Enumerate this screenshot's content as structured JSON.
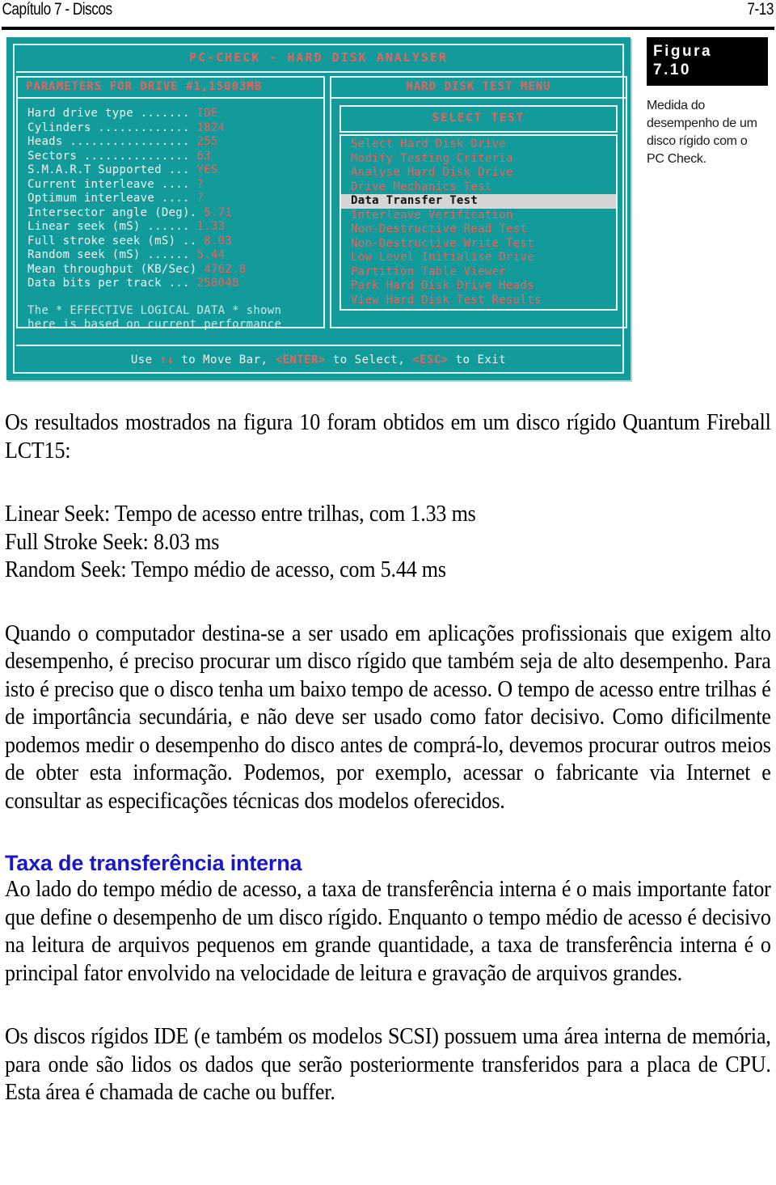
{
  "header": {
    "chapter": "Capítulo 7 - Discos",
    "folio": "7-13"
  },
  "figure": {
    "screen_title": "PC-CHECK - HARD DISK ANALYSER",
    "left_panel": {
      "heading": "PARAMETERS FOR DRIVE #1,15003MB",
      "rows": [
        {
          "label": "Hard drive type .......",
          "value": "IDE"
        },
        {
          "label": "Cylinders .............",
          "value": "1824"
        },
        {
          "label": "Heads .................",
          "value": "255"
        },
        {
          "label": "Sectors ...............",
          "value": "63"
        },
        {
          "label": "S.M.A.R.T Supported ...",
          "value": "YES"
        },
        {
          "label": "Current interleave ....",
          "value": "?"
        },
        {
          "label": "Optimum interleave ....",
          "value": "?"
        },
        {
          "label": "Intersector angle (Deg).",
          "value": "5.71"
        },
        {
          "label": "Linear seek (mS) ......",
          "value": "1.33"
        },
        {
          "label": "Full stroke seek (mS) ..",
          "value": "8.03"
        },
        {
          "label": "Random seek (mS) ......",
          "value": "5.44"
        },
        {
          "label": "Mean throughput (KB/Sec)",
          "value": "4762.8"
        },
        {
          "label": "Data bits per track ...",
          "value": "258048"
        }
      ],
      "note_line1": "The * EFFECTIVE LOGICAL DATA * shown",
      "note_line2": "here is based on current performance"
    },
    "right_panel": {
      "heading": "HARD DISK TEST MENU",
      "select_test_label": "SELECT TEST",
      "menu_items": [
        {
          "label": "Select Hard Disk Drive",
          "selected": false
        },
        {
          "label": "Modify Testing Criteria",
          "selected": false
        },
        {
          "label": "Analyse Hard Disk Drive",
          "selected": false
        },
        {
          "label": "Drive Mechanics Test",
          "selected": false
        },
        {
          "label": "Data Transfer Test",
          "selected": true
        },
        {
          "label": "Interleave Verification",
          "selected": false
        },
        {
          "label": "Non-Destructive Read Test",
          "selected": false
        },
        {
          "label": "Non-Destructive Write Test",
          "selected": false
        },
        {
          "label": "Low Level Initialise Drive",
          "selected": false
        },
        {
          "label": "Partition Table Viewer",
          "selected": false
        },
        {
          "label": "Park Hard Disk Drive Heads",
          "selected": false
        },
        {
          "label": "View Hard Disk Test Results",
          "selected": false
        }
      ]
    },
    "status_bar": {
      "part1": "Use ",
      "arrows": "↑↓",
      "part2": " to Move Bar, ",
      "key_enter": "<ENTER>",
      "part3": " to Select, ",
      "key_esc": "<ESC>",
      "part4": " to Exit"
    },
    "caption": {
      "tag_line1": "Figura",
      "tag_line2": "7.10",
      "text": "Medida do desempenho de um disco rígido com o PC Check."
    },
    "colors": {
      "screen_background": "#139b9b",
      "screen_accent": "#e8625c",
      "screen_text": "#f0f5f5",
      "selected_row_background": "#d6d6d6"
    }
  },
  "body": {
    "paragraph_intro": "Os resultados mostrados na figura 10 foram obtidos em um disco rígido Quantum Fireball LCT15:",
    "spec_lines": [
      "Linear Seek: Tempo de acesso entre trilhas, com 1.33 ms",
      "Full Stroke Seek: 8.03 ms",
      "Random Seek: Tempo médio de acesso, com 5.44 ms"
    ],
    "paragraph_performance": "Quando o computador destina-se a ser usado em aplicações profissionais que exigem alto desempenho, é preciso procurar um disco rígido que também seja de alto desempenho. Para isto é preciso que o disco tenha um baixo tempo de acesso. O tempo de acesso entre trilhas é de importância secundária, e não deve ser usado como fator decisivo. Como dificilmente podemos medir o desempenho do disco antes de comprá-lo, devemos procurar outros meios de obter esta informação. Podemos, por exemplo, acessar o fabricante via Internet e consultar as especificações técnicas dos modelos oferecidos.",
    "section_heading": "Taxa de transferência interna",
    "paragraph_transfer": "Ao lado do tempo médio de acesso, a taxa de transferência interna é o mais importante fator que define o desempenho de um disco rígido. Enquanto o tempo médio de acesso é decisivo na leitura de arquivos pequenos em grande quantidade, a taxa de transferência interna é o principal fator envolvido na velocidade de leitura e gravação de arquivos grandes.",
    "paragraph_cache": "Os discos rígidos IDE (e também os modelos SCSI) possuem uma área interna de memória, para onde são lidos os dados que serão posteriormente transferidos para a placa de CPU. Esta área é chamada de cache ou buffer.",
    "heading_color": "#1818c8"
  }
}
